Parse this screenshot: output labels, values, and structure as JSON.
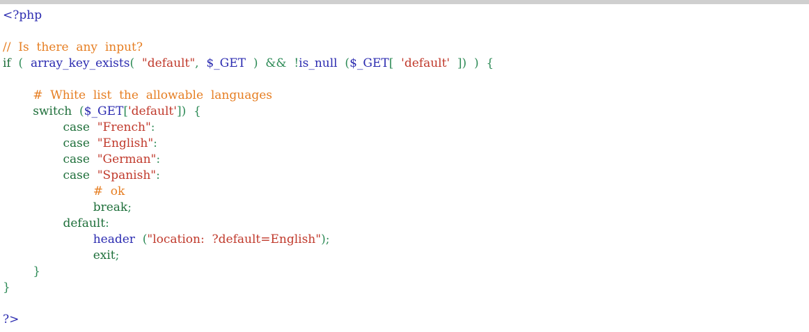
{
  "editor": {
    "lines": [
      [
        {
          "t": "<?php",
          "c": "tag"
        }
      ],
      [],
      [
        {
          "t": "//  Is  there  any  input?",
          "c": "cm"
        }
      ],
      [
        {
          "t": "if",
          "c": "kw"
        },
        {
          "t": "  (  ",
          "c": "op"
        },
        {
          "t": "array_key_exists",
          "c": "fn"
        },
        {
          "t": "(  ",
          "c": "op"
        },
        {
          "t": "\"default\"",
          "c": "str"
        },
        {
          "t": ",  ",
          "c": "op"
        },
        {
          "t": "$_GET",
          "c": "var"
        },
        {
          "t": "  )  ",
          "c": "op"
        },
        {
          "t": "&&",
          "c": "op"
        },
        {
          "t": "  !",
          "c": "op"
        },
        {
          "t": "is_null",
          "c": "fn"
        },
        {
          "t": "  (",
          "c": "op"
        },
        {
          "t": "$_GET",
          "c": "var"
        },
        {
          "t": "[  ",
          "c": "op"
        },
        {
          "t": "'default'",
          "c": "str"
        },
        {
          "t": "  ])  )  {",
          "c": "op"
        }
      ],
      [],
      [
        {
          "t": "        ",
          "c": "op"
        },
        {
          "t": "#  White  list  the  allowable  languages",
          "c": "cm"
        }
      ],
      [
        {
          "t": "        ",
          "c": "op"
        },
        {
          "t": "switch",
          "c": "kw"
        },
        {
          "t": "  (",
          "c": "op"
        },
        {
          "t": "$_GET",
          "c": "var"
        },
        {
          "t": "[",
          "c": "op"
        },
        {
          "t": "'default'",
          "c": "str"
        },
        {
          "t": "])  {",
          "c": "op"
        }
      ],
      [
        {
          "t": "                ",
          "c": "op"
        },
        {
          "t": "case",
          "c": "kw"
        },
        {
          "t": "  ",
          "c": "op"
        },
        {
          "t": "\"French\"",
          "c": "str"
        },
        {
          "t": ":",
          "c": "op"
        }
      ],
      [
        {
          "t": "                ",
          "c": "op"
        },
        {
          "t": "case",
          "c": "kw"
        },
        {
          "t": "  ",
          "c": "op"
        },
        {
          "t": "\"English\"",
          "c": "str"
        },
        {
          "t": ":",
          "c": "op"
        }
      ],
      [
        {
          "t": "                ",
          "c": "op"
        },
        {
          "t": "case",
          "c": "kw"
        },
        {
          "t": "  ",
          "c": "op"
        },
        {
          "t": "\"German\"",
          "c": "str"
        },
        {
          "t": ":",
          "c": "op"
        }
      ],
      [
        {
          "t": "                ",
          "c": "op"
        },
        {
          "t": "case",
          "c": "kw"
        },
        {
          "t": "  ",
          "c": "op"
        },
        {
          "t": "\"Spanish\"",
          "c": "str"
        },
        {
          "t": ":",
          "c": "op"
        }
      ],
      [
        {
          "t": "                        ",
          "c": "op"
        },
        {
          "t": "#  ok",
          "c": "cm"
        }
      ],
      [
        {
          "t": "                        ",
          "c": "op"
        },
        {
          "t": "break",
          "c": "kw"
        },
        {
          "t": ";",
          "c": "op"
        }
      ],
      [
        {
          "t": "                ",
          "c": "op"
        },
        {
          "t": "default",
          "c": "kw"
        },
        {
          "t": ":",
          "c": "op"
        }
      ],
      [
        {
          "t": "                        ",
          "c": "op"
        },
        {
          "t": "header",
          "c": "fn"
        },
        {
          "t": "  (",
          "c": "op"
        },
        {
          "t": "\"location:  ?default=English\"",
          "c": "str"
        },
        {
          "t": ");",
          "c": "op"
        }
      ],
      [
        {
          "t": "                        ",
          "c": "op"
        },
        {
          "t": "exit",
          "c": "kw"
        },
        {
          "t": ";",
          "c": "op"
        }
      ],
      [
        {
          "t": "        ",
          "c": "op"
        },
        {
          "t": "}",
          "c": "op"
        }
      ],
      [
        {
          "t": "}",
          "c": "op"
        }
      ],
      [],
      [
        {
          "t": "?>",
          "c": "tag"
        }
      ]
    ]
  }
}
